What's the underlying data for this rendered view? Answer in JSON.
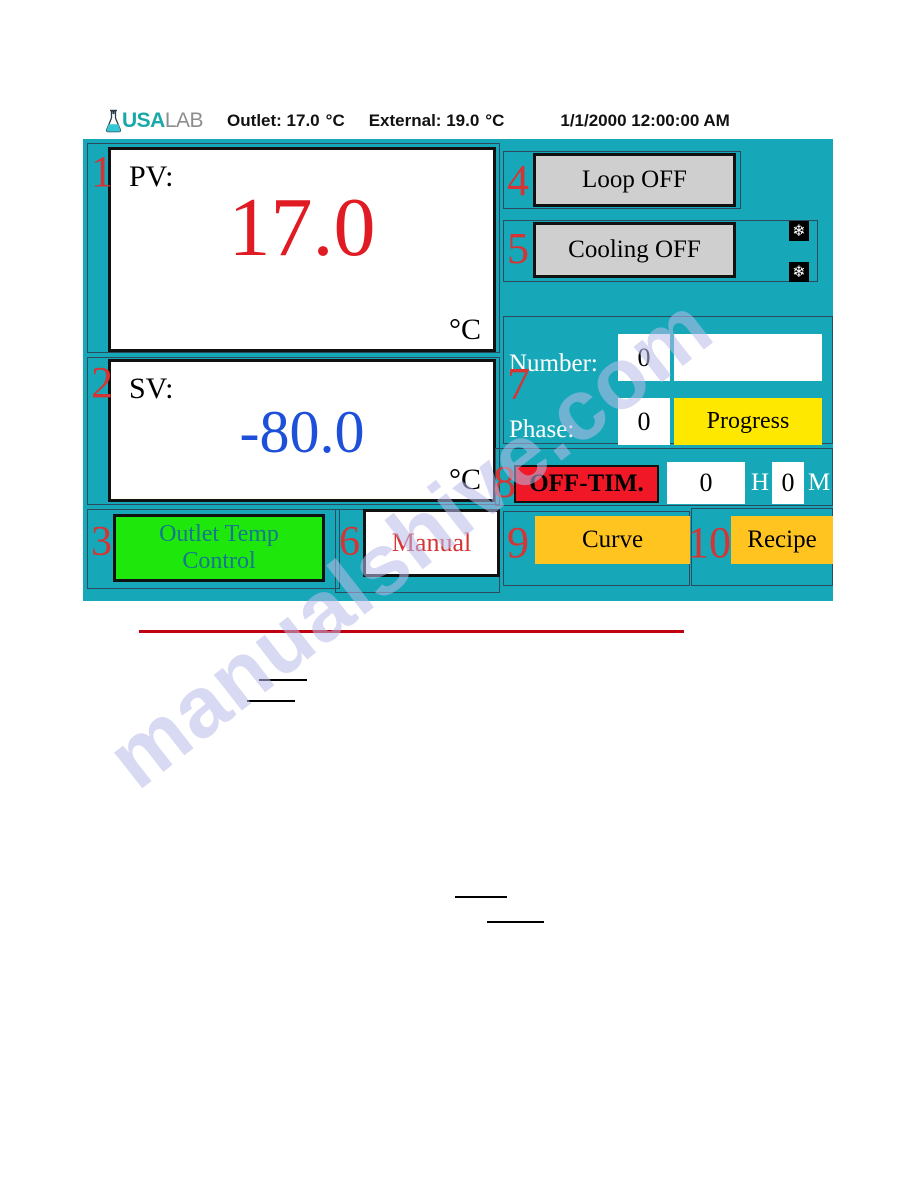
{
  "page": {
    "watermark_text": "manualshive.com"
  },
  "hmi": {
    "background_color": "#16a8b8",
    "header": {
      "logo": {
        "icon": "flask-icon",
        "brand_primary": "USA",
        "brand_secondary": "LAB",
        "primary_color": "#1aa8a8",
        "secondary_color": "#8d8d8d"
      },
      "outlet_label": "Outlet: 17.0",
      "outlet_unit": "°C",
      "external_label": "External: 19.0",
      "external_unit": "°C",
      "datetime": "1/1/2000  12:00:00  AM"
    },
    "markers": {
      "m1": "1",
      "m2": "2",
      "m3": "3",
      "m4": "4",
      "m5": "5",
      "m6": "6",
      "m7": "7",
      "m8": "8",
      "m9": "9",
      "m10": "10",
      "color": "#d63434"
    },
    "pv_panel": {
      "label": "PV:",
      "value": "17.0",
      "value_color": "#e01b24",
      "unit": "°C"
    },
    "sv_panel": {
      "label": "SV:",
      "value": "-80.0",
      "value_color": "#1d4fd8",
      "unit": "°C"
    },
    "loop_button": {
      "label": "Loop OFF",
      "color": "#cfcfcf"
    },
    "cooling_button": {
      "label": "Cooling OFF",
      "color": "#cfcfcf"
    },
    "snowflake_icons": {
      "glyph": "❄",
      "count": 2
    },
    "program_panel": {
      "number_label": "Number:",
      "number_value": "0",
      "number_name_value": "",
      "phase_label": "Phase:",
      "phase_value": "0",
      "progress_label": "Progress",
      "progress_color": "#ffe800"
    },
    "off_timer": {
      "label": "OFF-TIM.",
      "label_color": "#f01826",
      "hours_value": "0",
      "hours_unit": "H",
      "minutes_value": "0",
      "minutes_unit": "M"
    },
    "outlet_temp_control": {
      "line1": "Outlet   Temp",
      "line2": "Control",
      "color": "#1ee80b",
      "text_color": "#16778f"
    },
    "manual_button": {
      "label": "Manual",
      "text_color": "#d63434"
    },
    "curve_button": {
      "label": "Curve",
      "color": "#ffc41f"
    },
    "recipe_button": {
      "label": "Recipe",
      "color": "#ffc41f"
    }
  }
}
